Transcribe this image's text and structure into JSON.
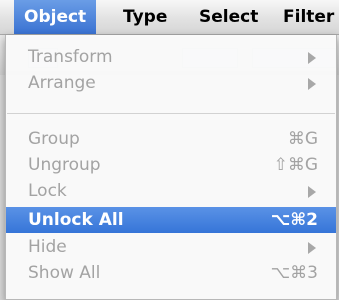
{
  "menubar": {
    "items": [
      {
        "label": "Object"
      },
      {
        "label": "Type"
      },
      {
        "label": "Select"
      },
      {
        "label": "Filter"
      }
    ]
  },
  "menu": {
    "items": [
      {
        "label": "Transform",
        "shortcut": "",
        "submenu": true
      },
      {
        "label": "Arrange",
        "shortcut": "",
        "submenu": true
      },
      {
        "label": "Group",
        "shortcut": "⌘G",
        "submenu": false
      },
      {
        "label": "Ungroup",
        "shortcut": "⇧⌘G",
        "submenu": false
      },
      {
        "label": "Lock",
        "shortcut": "",
        "submenu": true
      },
      {
        "label": "Unlock All",
        "shortcut": "⌥⌘2",
        "submenu": false
      },
      {
        "label": "Hide",
        "shortcut": "",
        "submenu": true
      },
      {
        "label": "Show All",
        "shortcut": "⌥⌘3",
        "submenu": false
      }
    ]
  },
  "colors": {
    "highlight": "#3a75d8",
    "disabled_text": "#a3a3a3"
  }
}
